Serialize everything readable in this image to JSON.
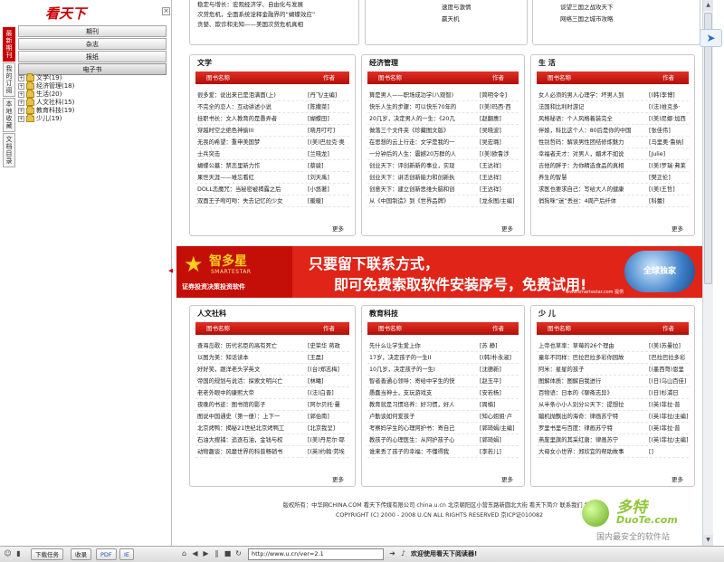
{
  "sidebar": {
    "brand": "看天下",
    "close": "×",
    "vtabs": [
      {
        "label": "最新期刊",
        "active": true
      },
      {
        "label": "我的订阅",
        "active": false
      },
      {
        "label": "本地收藏",
        "active": false
      },
      {
        "label": "文档目录",
        "active": false
      }
    ],
    "menu": [
      {
        "label": "期刊",
        "active": false
      },
      {
        "label": "杂志",
        "active": false
      },
      {
        "label": "报纸",
        "active": false
      },
      {
        "label": "电子书",
        "active": true
      }
    ],
    "tree": [
      {
        "toggle": "+",
        "label": "文学(19)"
      },
      {
        "toggle": "+",
        "label": "经济管理(18)"
      },
      {
        "toggle": "+",
        "label": "生活(20)"
      },
      {
        "toggle": "+",
        "label": "人文社科(15)"
      },
      {
        "toggle": "+",
        "label": "教育科技(19)"
      },
      {
        "toggle": "+",
        "label": "少儿(19)"
      }
    ],
    "collapse": "◀"
  },
  "top_strip": {
    "col1": [
      "稳定与增长：宏观经济学、自由化与发展",
      "次贷危机，全面系统诠释金融界的“蝴蝶效应”",
      "贪婪、欺诈和无知——美国次贷危机真相"
    ],
    "col2": [
      "速度与激情",
      "赢天机"
    ],
    "col3": [
      "谈望三国之战攻天下",
      "网络三国之城市攻略"
    ]
  },
  "panels": [
    {
      "id": "literature",
      "title": "文学",
      "h1": "图书名称",
      "h2": "作者",
      "rows": [
        [
          "很多爱：说出来已是泪满面(上)",
          "[丹飞/主编]"
        ],
        [
          "不完全的恋人：互动讲述小说",
          "[陈撒菜]"
        ],
        [
          "挂职书长：文人教育的是愚弄者",
          "[蝴蝶田]"
        ],
        [
          "穿越时空之绝色神偷III",
          "[晓月叮叮]"
        ],
        [
          "无畏的希望：重申美国梦",
          "[(美)巴拉克·奥"
        ],
        [
          "士兵突击",
          "[兰晓龙]"
        ],
        [
          "蝴蝶公墓：禁恋里新力作",
          "[蔡骏]"
        ],
        [
          "果世天涯——难忘看红",
          "[刘天禹]"
        ],
        [
          "DOLL恋魔咒：当秘密被揭露之后",
          "[小悠著]"
        ],
        [
          "双面王子吻可吻：失去记忆的少女",
          "[暖暖]"
        ]
      ],
      "more": "更多"
    },
    {
      "id": "economics",
      "title": "经济管理",
      "h1": "图书名称",
      "h2": "作者",
      "rows": [
        [
          "算是男人——职场成功学(八观智)",
          "[简明令令]"
        ],
        [
          "快乐人生的步骤：可以快乐70年的",
          "[(美)玛西·西"
        ],
        [
          "20几岁，决定男人的一生：《20几",
          "[赵翻惠]"
        ],
        [
          "做落三个文件夹《珍藏图文版》",
          "[吴晓波]"
        ],
        [
          "在思想的云上行走：文学是我的一",
          "[吴宏璐]"
        ],
        [
          "一分钟后的人生：震撼20万群的人",
          "[(美)欧鲁涉"
        ],
        [
          "创业天下：评创新新的事业，实现",
          "[王达祥]"
        ],
        [
          "创业天下：讲活创新能力和创新执",
          "[王达祥]"
        ],
        [
          "创意天下：建立创新思维头脑和创",
          "[王达祥]"
        ],
        [
          "从《中国制造》到《世界品牌》",
          "[龙永图/主编]"
        ]
      ],
      "more": "更多"
    },
    {
      "id": "life",
      "title": "生 活",
      "h1": "图书名称",
      "h2": "作者",
      "rows": [
        [
          "女人必须的男人心理学：坏男人到",
          "[(韩)李博]"
        ],
        [
          "法国和比利时游记",
          "[(法)维克多·"
        ],
        [
          "风格秘语：个人风格着装完全",
          "[(美)尼娜·加西"
        ],
        [
          "伴娘，科比这个人：80后是你的中国",
          "[张佳伟]"
        ],
        [
          "性别哲码：解读男性团结修炼魅力",
          "[马里奥·鲁纳]"
        ],
        [
          "幸福者夫才：对男人，媚术不如说",
          "[Julie]"
        ],
        [
          "吉他的胖子：为你精选食品的真相",
          "[(美)罗瑞·弗莱"
        ],
        [
          "养生的智慧",
          "[樊正伦]"
        ],
        [
          "求医也要求自己：写给大人的健康",
          "[(美)王哲]"
        ],
        [
          "俏狗咪“迷”丢丝：4周产后纤体",
          "[科蕾]"
        ]
      ],
      "more": "更多"
    },
    {
      "id": "humanities",
      "title": "人文社科",
      "h1": "图书名称",
      "h2": "作者",
      "rows": [
        [
          "查海岛歌：历代名臣的高有死亡",
          "[史荣华 蒋政"
        ],
        [
          "以图为美：知话读本",
          "[王磊]"
        ],
        [
          "好好笑，跟洋老头学英文",
          "[(台)郑志梅]"
        ],
        [
          "帝国的规划与说活：探索文明兴亡",
          "[林曦]"
        ],
        [
          "老老外眼中的康熙大帝",
          "[(法)白晋]"
        ],
        [
          "夜晚的书迹：图书馆的影子",
          "[阿尔贝托·曼"
        ],
        [
          "图说中国通史（第一册）：上下一",
          "[郭伯南]"
        ],
        [
          "北京烤鸭：揭秘21世纪北京烤鸭工",
          "[北京我呈]"
        ],
        [
          "石油大搜捕：追逐石油，金钱与权",
          "[(美)丹尼尔·耶"
        ],
        [
          "动物趣谈：风靡世界的科普畅销书",
          "[(英)约翰·劳埃"
        ]
      ],
      "more": "更多"
    },
    {
      "id": "education",
      "title": "教育科技",
      "h1": "图书名称",
      "h2": "作者",
      "rows": [
        [
          "先什么让学生爱上你",
          "[苏 静]"
        ],
        [
          "17岁，决定孩子的一生II",
          "[(韩)朴永淑]"
        ],
        [
          "10几岁，决定孩子的一生I",
          "[沈德新]"
        ],
        [
          "智者善通心领导：寄给中学生的快",
          "[赵玉平]"
        ],
        [
          "愚蠢当神士，支玩游戏支",
          "[安若杨]"
        ],
        [
          "教育就是习惯培养：好习惯，好人",
          "[周楠]"
        ],
        [
          "卢勤谈如何爱孩子",
          "[知心姐姐·卢"
        ],
        [
          "考察妈学生的心理阿护书：寄自己",
          "[郭琦娟/主编]"
        ],
        [
          "教孩子的心理医生：从阿护孩子心",
          "[郭琦娟]"
        ],
        [
          "谁来丢了孩子的幸福：不懂得我",
          "[李若儿]"
        ]
      ],
      "more": "更多"
    },
    {
      "id": "children",
      "title": "少 儿",
      "h1": "图书名称",
      "h2": "作者",
      "rows": [
        [
          "上帝也草率：草莓的26个理由",
          "[(美)苏曼拉]"
        ],
        [
          "童年不同样：巴拉巴拉多彩你园故",
          "[巴拉巴拉多彩"
        ],
        [
          "阿米：星星的孩子",
          "[(墨西哥)恩里"
        ],
        [
          "图解体质：图解自我进行",
          "[(日)乌山百佳]"
        ],
        [
          "百物语：日本的《聊斋志异》",
          "[(日)杉浦日"
        ],
        [
          "从半条小小人别分公天下：提想拉",
          "[(英)菲拉·普"
        ],
        [
          "蹦机抛飘出的海奇：律画苏宁特",
          "[(英)菲拉/主编]"
        ],
        [
          "罗里书里与百度：律画苏宁特",
          "[(英)菲拉·普"
        ],
        [
          "燕废里旗的其采红唐：律画苏宁",
          "[(英)菲拉/主编]"
        ],
        [
          "大母女小世界：郑欣宜的帮助故事",
          "[]"
        ]
      ],
      "more": "更多"
    }
  ],
  "banner": {
    "brand_cn": "智多星",
    "brand_en": "SMARTESTAR",
    "tagline": "证券投资决策投资软件",
    "line1": "只要留下联系方式，",
    "line2": "即可免费索取软件安装序号，免费试用!",
    "sub": "www.smartestar.com 提供",
    "globe": "全球独家"
  },
  "footer": {
    "line1": "版权所有：中华网CHINA.COM 看天下传媒有限公司 china.u.cn 北京朝阳区小营东路新圆北大街 看天下简介 联系我们 招商",
    "line2": "COPYRIGHT (C) 2000 - 2008 U.CN ALL RIGHTS RESERVED 京ICP证010082"
  },
  "watermark": {
    "w1": "多特",
    "w2": "DuoTe.com",
    "w3": "国内最安全的软件站"
  },
  "statusbar": {
    "download_tasks": "下载任务",
    "collect": "收录",
    "pdf": "PDF",
    "ie": "IE",
    "url": "http://www.u.cn/ver=2.1",
    "welcome": "欢迎使用看天下阅读器!"
  }
}
